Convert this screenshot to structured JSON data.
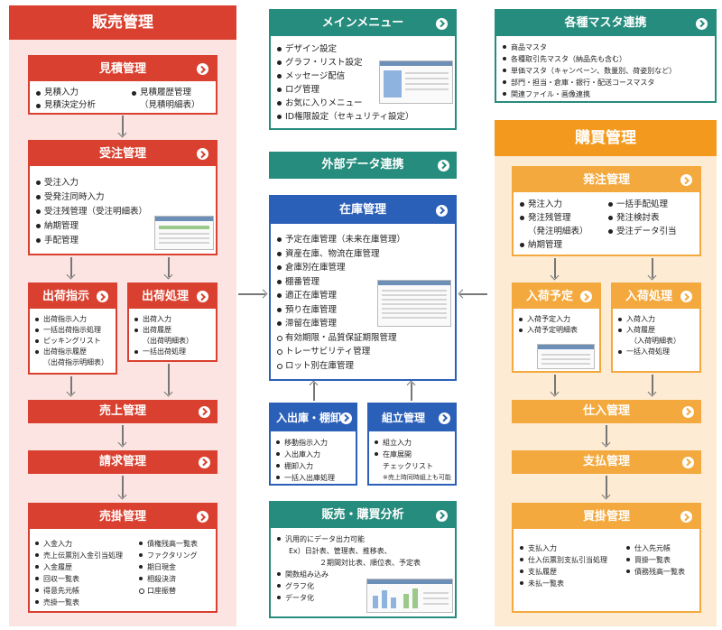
{
  "sales": {
    "title": "販売管理",
    "estimate": {
      "title": "見積管理",
      "left": [
        "見積入力",
        "見積決定分析"
      ],
      "right": [
        "見積履歴管理"
      ],
      "right_cont": "（見積明細表）"
    },
    "order": {
      "title": "受注管理",
      "items": [
        "受注入力",
        "受発注同時入力",
        "受注残管理（受注明細表）",
        "納期管理",
        "手配管理"
      ]
    },
    "ship_instr": {
      "title": "出荷指示",
      "items": [
        "出荷指示入力",
        "一括出荷指示処理",
        "ピッキングリスト",
        "出荷指示履歴"
      ],
      "cont": "（出荷指示明細表）"
    },
    "ship_proc": {
      "title": "出荷処理",
      "items": [
        "出荷入力",
        "出荷履歴"
      ],
      "cont": "（出荷明細表）",
      "items2": [
        "一括出荷処理"
      ]
    },
    "sales_mgmt": {
      "title": "売上管理"
    },
    "billing": {
      "title": "請求管理"
    },
    "receivable": {
      "title": "売掛管理",
      "left": [
        "入金入力",
        "売上伝票別入金引当処理",
        "入金履歴",
        "回収一覧表",
        "得意先元帳",
        "売掛一覧表"
      ],
      "right": [
        "債権残高一覧表",
        "ファクタリング",
        "期日現金",
        "相殺決済"
      ],
      "right_ring": [
        "口座振替"
      ]
    }
  },
  "menu": {
    "title": "メインメニュー",
    "items": [
      "デザイン設定",
      "グラフ・リスト設定",
      "メッセージ配信",
      "ログ管理",
      "お気に入りメニュー",
      "ID権限設定（セキュリティ設定）"
    ]
  },
  "external": {
    "title": "外部データ連携"
  },
  "inventory": {
    "title": "在庫管理",
    "items": [
      "予定在庫管理（未来在庫管理）",
      "資産在庫、物流在庫管理",
      "倉庫別在庫管理",
      "棚番管理",
      "適正在庫管理",
      "預り在庫管理",
      "滞留在庫管理"
    ],
    "ring_items": [
      "有効期限・品質保証期限管理",
      "トレーサビリティ管理",
      "ロット別在庫管理"
    ]
  },
  "inout": {
    "title": "入出庫・棚卸",
    "items": [
      "移動指示入力",
      "入出庫入力",
      "棚卸入力",
      "一括入出庫処理"
    ]
  },
  "assembly": {
    "title": "組立管理",
    "items": [
      "組立入力",
      "在庫展開"
    ],
    "cont": "チェックリスト",
    "note": "※売上時同時組上も可能"
  },
  "analysis": {
    "title": "販売・購買分析",
    "items": [
      "汎用的にデータ出力可能"
    ],
    "ex1": "Ex）日計表、管理表、推移表、",
    "ex2": "２期間対比表、順位表、予定表",
    "items2": [
      "関数組み込み",
      "グラフ化",
      "データ化"
    ]
  },
  "master": {
    "title": "各種マスタ連携",
    "items": [
      "商品マスタ",
      "各種取引先マスタ（納品先も含む）",
      "単価マスタ（キャンペーン、数量別、荷姿別など）",
      "部門・担当・倉庫・銀行・配送コースマスタ",
      "関連ファイル・画像連携"
    ]
  },
  "purchase": {
    "title": "購買管理",
    "po": {
      "title": "発注管理",
      "left": [
        "発注入力",
        "発注残管理"
      ],
      "left_cont": "（発注明細表）",
      "left2": [
        "納期管理"
      ],
      "right": [
        "一括手配処理",
        "発注検討表",
        "受注データ引当"
      ]
    },
    "arrival_plan": {
      "title": "入荷予定",
      "items": [
        "入荷予定入力",
        "入荷予定明細表"
      ]
    },
    "arrival_proc": {
      "title": "入荷処理",
      "items": [
        "入荷入力",
        "入荷履歴"
      ],
      "cont": "（入荷明細表）",
      "items2": [
        "一括入荷処理"
      ]
    },
    "stock_in": {
      "title": "仕入管理"
    },
    "payment": {
      "title": "支払管理"
    },
    "payable": {
      "title": "買掛管理",
      "left": [
        "支払入力",
        "仕入伝票別支払引当処理",
        "支払履歴",
        "未払一覧表"
      ],
      "right": [
        "仕入先元帳",
        "買掛一覧表",
        "債務残高一覧表"
      ]
    }
  }
}
